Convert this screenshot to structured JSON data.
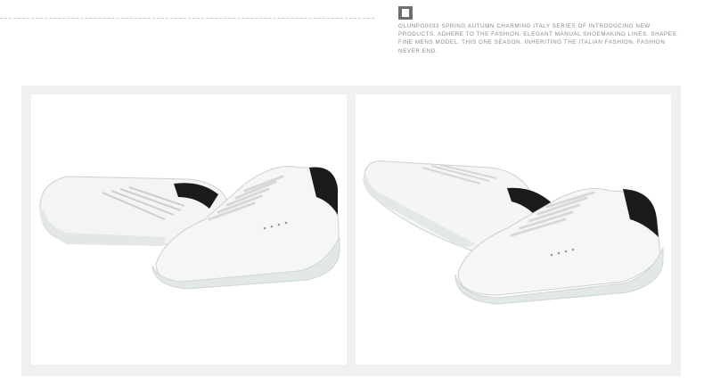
{
  "header": {
    "description": "OLUNPO0033 SPRING AUTUMN CHARMING ITALY SERIES OF INTRODUCING NEW PRODUCTS. ADHERE TO THE FASHION. ELEGANT MANUAL SHOEMAKING LINES. SHAPES. FINE MENS MODEL. THIS ONE SEASON. INHERITING THE ITALIAN FASHION. FASHION NEVER END."
  },
  "colors": {
    "frame": "#f0f0f0",
    "shoe_upper": "#f5f5f5",
    "heel_tab": "#1b1b1b",
    "sole": "#e2e8e6"
  },
  "icons": [
    "logo-mark-icon"
  ]
}
